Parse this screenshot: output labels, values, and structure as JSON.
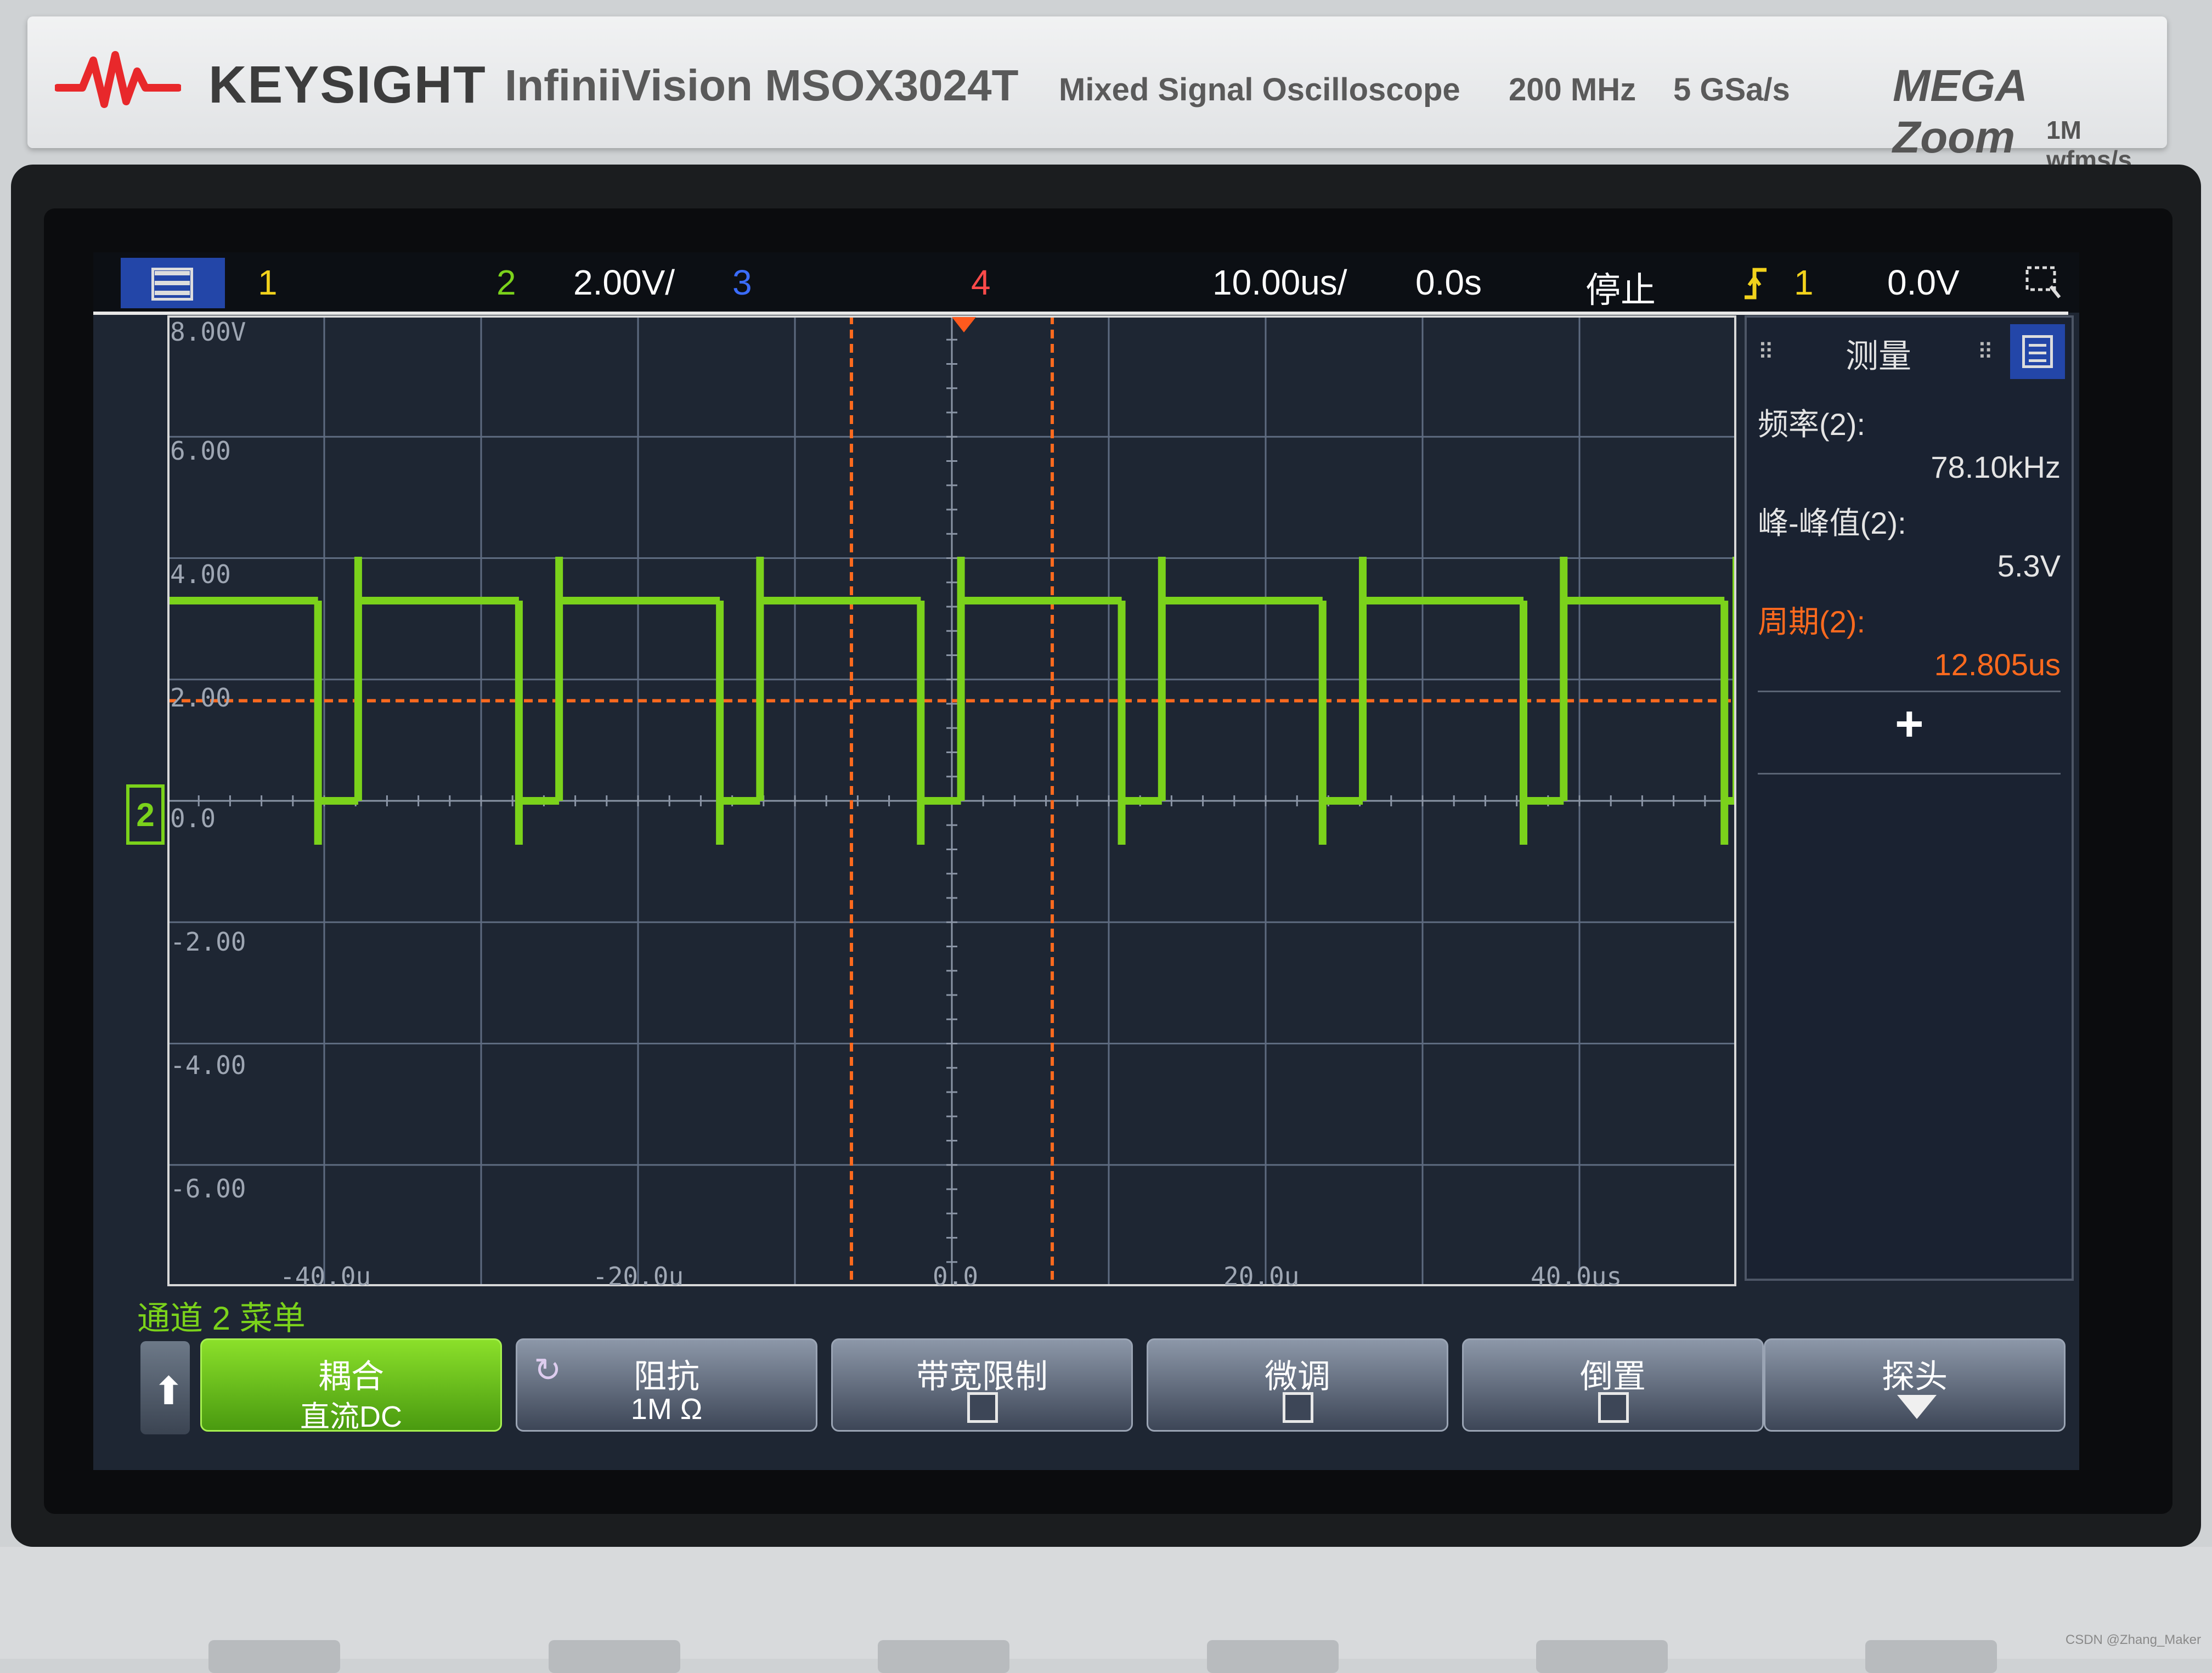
{
  "brand": {
    "name": "KEYSIGHT",
    "model": "InfiniiVision MSOX3024T",
    "description": "Mixed Signal Oscilloscope",
    "bandwidth": "200 MHz",
    "sample_rate": "5 GSa/s",
    "megazoom_logo": "MEGA Zoom",
    "megazoom_sub": "1M wfms/s",
    "logo_color": "#e8282b"
  },
  "status_bar": {
    "ch1": "1",
    "ch2": "2",
    "ch2_scale": "2.00V/",
    "ch3": "3",
    "ch4": "4",
    "timebase": "10.00us/",
    "delay": "0.0s",
    "run_state": "停止",
    "trigger_source": "1",
    "trigger_level": "0.0V",
    "colors": {
      "ch1": "#f2d21c",
      "ch2": "#7bd21b",
      "ch3": "#3a6cff",
      "ch4": "#ff4a4a"
    }
  },
  "graticule": {
    "y_labels": [
      "8.00V",
      "6.00",
      "4.00",
      "2.00",
      "0.0",
      "-2.00",
      "-4.00",
      "-6.00"
    ],
    "x_labels": [
      "-40.0u",
      "-20.0u",
      "0.0",
      "20.0u",
      "40.0us"
    ],
    "ch2_marker": "2",
    "colors": {
      "grid": "#5e6b80",
      "trace": "#7bd21b",
      "cursor": "#ff6a1e"
    }
  },
  "chart_data": {
    "type": "line",
    "series": [
      {
        "name": "2",
        "description_values": "square wave, high ≈ 3.3 V, low ≈ 0 V, short negative edge spikes",
        "period_us": 12.805,
        "high_v": 3.3,
        "low_v": 0.0,
        "duty_high": 0.8
      }
    ],
    "xlim": [
      -50,
      50
    ],
    "ylim": [
      -8,
      8
    ],
    "x_unit": "us",
    "y_unit": "V",
    "cursors": {
      "x1_us": -6.4,
      "x2_us": 6.4,
      "y_v": 1.65
    }
  },
  "measurements": {
    "title": "测量",
    "items": [
      {
        "label": "频率(2):",
        "value": "78.10kHz",
        "label_color": "#e4e4e4",
        "value_color": "#e4e4e4"
      },
      {
        "label": "峰-峰值(2):",
        "value": "5.3V",
        "label_color": "#e4e4e4",
        "value_color": "#e4e4e4"
      },
      {
        "label": "周期(2):",
        "value": "12.805us",
        "label_color": "#ff6a1e",
        "value_color": "#ff6a1e"
      }
    ],
    "add_symbol": "+"
  },
  "softkey_menu": {
    "title": "通道 2 菜单",
    "back_symbol": "🡅",
    "keys": [
      {
        "title": "耦合",
        "value": "直流DC"
      },
      {
        "title": "阻抗",
        "value": "1M Ω",
        "icon": "↻"
      },
      {
        "title": "带宽限制"
      },
      {
        "title": "微调"
      },
      {
        "title": "倒置"
      },
      {
        "title": "探头"
      }
    ]
  },
  "watermark": "CSDN @Zhang_Maker"
}
